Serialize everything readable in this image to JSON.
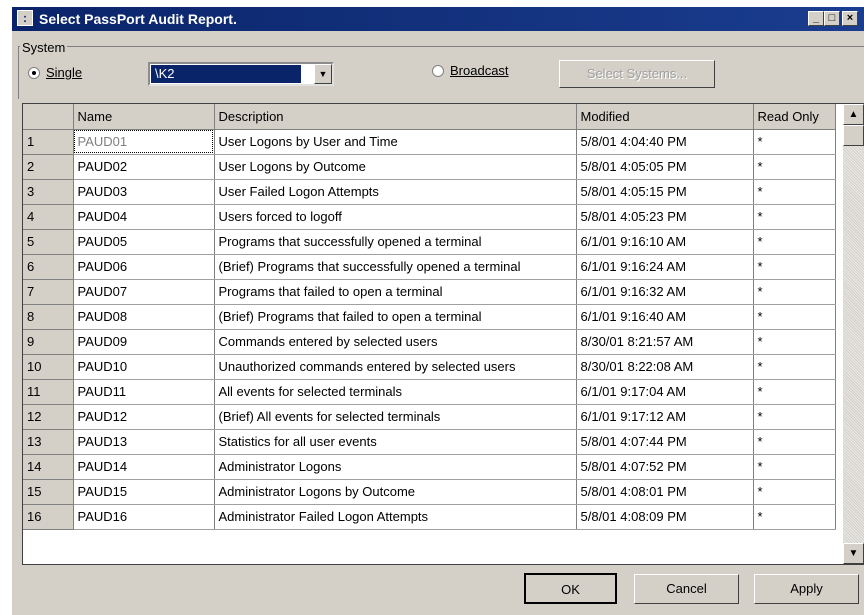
{
  "window": {
    "title": "Select PassPort Audit Report.",
    "minimize_glyph": "_",
    "maximize_glyph": "□",
    "close_glyph": "×"
  },
  "system": {
    "group_label": "System",
    "single_label": "Single",
    "single_selected": true,
    "system_value": "\\K2",
    "broadcast_label": "Broadcast",
    "select_systems_label": "Select Systems..."
  },
  "grid": {
    "columns": [
      "",
      "Name",
      "Description",
      "Modified",
      "Read Only"
    ],
    "rows": [
      {
        "num": "1",
        "name": "PAUD01",
        "description": "User Logons by User and Time",
        "modified": "5/8/01 4:04:40 PM",
        "read_only": "*"
      },
      {
        "num": "2",
        "name": "PAUD02",
        "description": "User Logons by Outcome",
        "modified": "5/8/01 4:05:05 PM",
        "read_only": "*"
      },
      {
        "num": "3",
        "name": "PAUD03",
        "description": "User Failed Logon Attempts",
        "modified": "5/8/01 4:05:15 PM",
        "read_only": "*"
      },
      {
        "num": "4",
        "name": "PAUD04",
        "description": "Users forced to logoff",
        "modified": "5/8/01 4:05:23 PM",
        "read_only": "*"
      },
      {
        "num": "5",
        "name": "PAUD05",
        "description": "Programs that successfully opened a terminal",
        "modified": "6/1/01 9:16:10 AM",
        "read_only": "*"
      },
      {
        "num": "6",
        "name": "PAUD06",
        "description": "(Brief) Programs that successfully opened a terminal",
        "modified": "6/1/01 9:16:24 AM",
        "read_only": "*"
      },
      {
        "num": "7",
        "name": "PAUD07",
        "description": "Programs that failed to open a terminal",
        "modified": "6/1/01 9:16:32 AM",
        "read_only": "*"
      },
      {
        "num": "8",
        "name": "PAUD08",
        "description": "(Brief) Programs that failed to open a terminal",
        "modified": "6/1/01 9:16:40 AM",
        "read_only": "*"
      },
      {
        "num": "9",
        "name": "PAUD09",
        "description": "Commands entered by selected users",
        "modified": "8/30/01 8:21:57 AM",
        "read_only": "*"
      },
      {
        "num": "10",
        "name": "PAUD10",
        "description": "Unauthorized commands entered by selected users",
        "modified": "8/30/01 8:22:08 AM",
        "read_only": "*"
      },
      {
        "num": "11",
        "name": "PAUD11",
        "description": "All events for selected terminals",
        "modified": "6/1/01 9:17:04 AM",
        "read_only": "*"
      },
      {
        "num": "12",
        "name": "PAUD12",
        "description": "(Brief) All events for selected terminals",
        "modified": "6/1/01 9:17:12 AM",
        "read_only": "*"
      },
      {
        "num": "13",
        "name": "PAUD13",
        "description": "Statistics for all user events",
        "modified": "5/8/01 4:07:44 PM",
        "read_only": "*"
      },
      {
        "num": "14",
        "name": "PAUD14",
        "description": "Administrator Logons",
        "modified": "5/8/01 4:07:52 PM",
        "read_only": "*"
      },
      {
        "num": "15",
        "name": "PAUD15",
        "description": "Administrator Logons by Outcome",
        "modified": "5/8/01 4:08:01 PM",
        "read_only": "*"
      },
      {
        "num": "16",
        "name": "PAUD16",
        "description": "Administrator Failed Logon Attempts",
        "modified": "5/8/01 4:08:09 PM",
        "read_only": "*"
      }
    ]
  },
  "buttons": {
    "ok": "OK",
    "cancel": "Cancel",
    "apply": "Apply"
  }
}
